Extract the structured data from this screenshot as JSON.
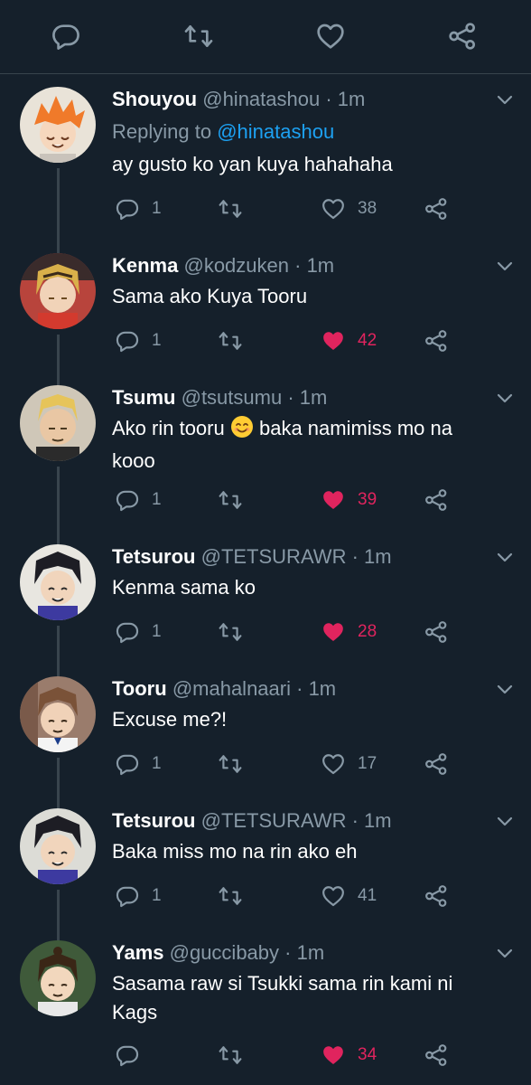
{
  "colors": {
    "background": "#15202b",
    "divider": "#38444d",
    "muted": "#8899a6",
    "link": "#1da1f2",
    "like": "#e0245e",
    "text": "#ffffff"
  },
  "top_actions": [
    {
      "icon": "reply-icon"
    },
    {
      "icon": "retweet-icon"
    },
    {
      "icon": "like-icon"
    },
    {
      "icon": "share-icon"
    }
  ],
  "tweets": [
    {
      "name": "Shouyou",
      "handle": "@hinatashou",
      "time": "· 1m",
      "replying_prefix": "Replying to",
      "replying_to": "@hinatashou",
      "text": "ay gusto ko yan kuya hahahaha",
      "replies": "1",
      "likes": "38",
      "liked": false
    },
    {
      "name": "Kenma",
      "handle": "@kodzuken",
      "time": "· 1m",
      "text": "Sama ako Kuya Tooru",
      "replies": "1",
      "likes": "42",
      "liked": true
    },
    {
      "name": "Tsumu",
      "handle": "@tsutsumu",
      "time": "· 1m",
      "text_before_emoji": "Ako rin tooru",
      "emoji": "smiling-face-emoji",
      "text_after_emoji": "baka namimiss mo na",
      "text_line2": "kooo",
      "replies": "1",
      "likes": "39",
      "liked": true
    },
    {
      "name": "Tetsurou",
      "handle": "@TETSURAWR",
      "time": "· 1m",
      "text": "Kenma sama ko",
      "replies": "1",
      "likes": "28",
      "liked": true
    },
    {
      "name": "Tooru",
      "handle": "@mahalnaari",
      "time": "· 1m",
      "text": "Excuse me?!",
      "replies": "1",
      "likes": "17",
      "liked": false
    },
    {
      "name": "Tetsurou",
      "handle": "@TETSURAWR",
      "time": "· 1m",
      "text": "Baka miss mo na rin ako eh",
      "replies": "1",
      "likes": "41",
      "liked": false
    },
    {
      "name": "Yams",
      "handle": "@guccibaby",
      "time": "· 1m",
      "text": "Sasama raw si Tsukki sama rin kami ni",
      "text_line2": "Kags",
      "replies": "",
      "likes": "34",
      "liked": true
    }
  ]
}
